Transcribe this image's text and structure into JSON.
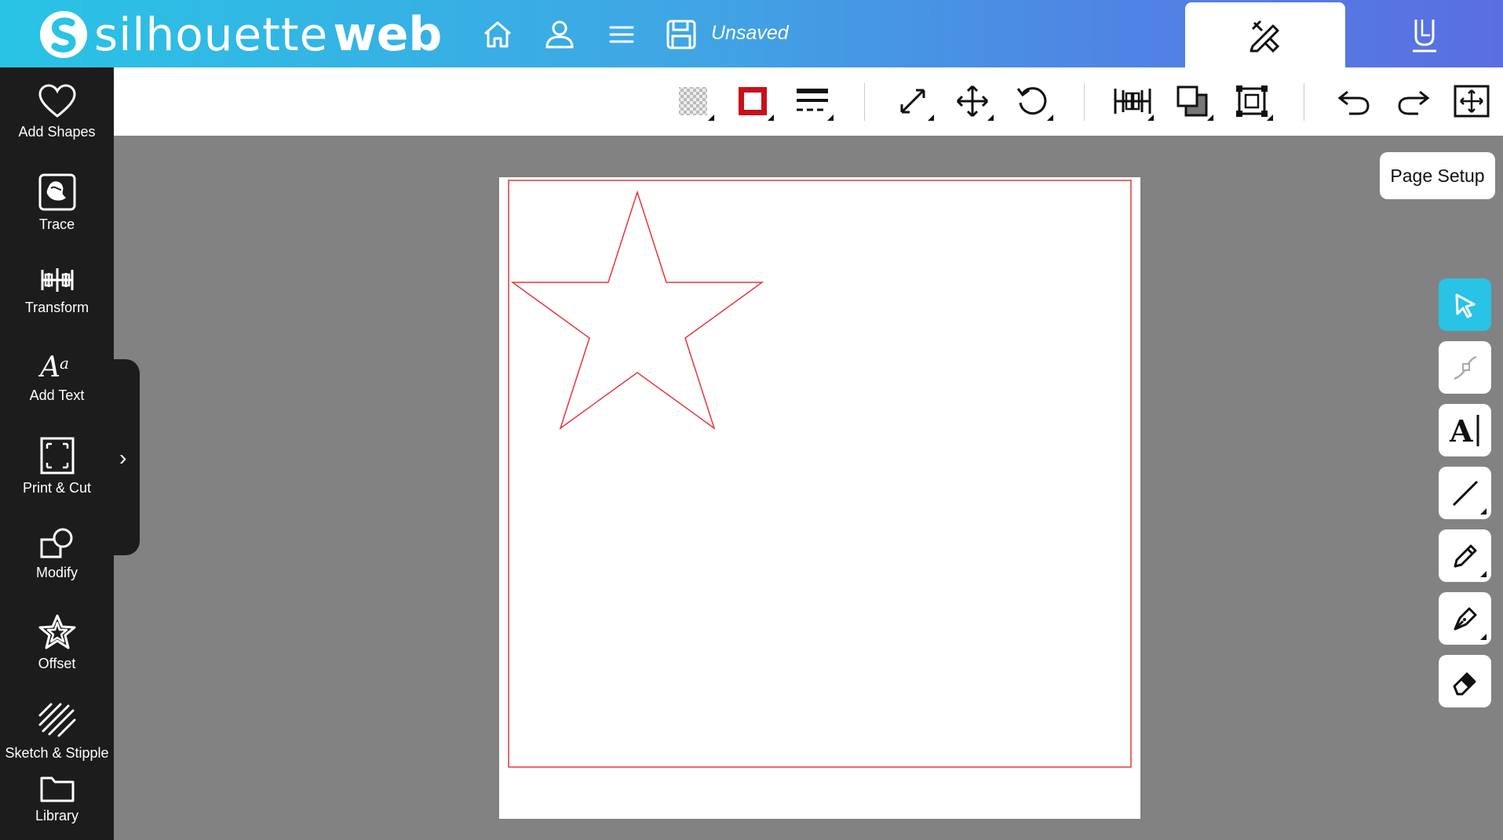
{
  "header": {
    "logo_light": "silhouette",
    "logo_bold": "web",
    "save_status": "Unsaved",
    "icons": [
      "home-icon",
      "account-icon",
      "menu-icon",
      "save-icon"
    ],
    "tabs": [
      "design-tab",
      "send-tab"
    ]
  },
  "sidebar": {
    "items": [
      {
        "label": "Add Shapes",
        "icon": "heart-icon"
      },
      {
        "label": "Trace",
        "icon": "trace-icon"
      },
      {
        "label": "Transform",
        "icon": "transform-icon"
      },
      {
        "label": "Add Text",
        "icon": "text-icon"
      },
      {
        "label": "Print & Cut",
        "icon": "print-cut-icon"
      },
      {
        "label": "Modify",
        "icon": "modify-icon"
      },
      {
        "label": "Offset",
        "icon": "offset-icon"
      },
      {
        "label": "Sketch & Stipple",
        "icon": "sketch-icon"
      },
      {
        "label": "Library",
        "icon": "folder-icon"
      }
    ],
    "flap_toggle": "›"
  },
  "toolbar": {
    "tools": [
      "fill-icon",
      "line-color-icon",
      "line-style-icon",
      "scale-icon",
      "move-icon",
      "rotate-icon",
      "align-icon",
      "arrange-icon",
      "group-icon",
      "undo-icon",
      "redo-icon",
      "pan-icon"
    ]
  },
  "page_setup": {
    "label": "Page Setup"
  },
  "right_tools": [
    "select-icon",
    "edit-points-icon",
    "text-tool-icon",
    "line-tool-icon",
    "pencil-icon",
    "pen-icon",
    "eraser-icon"
  ],
  "colors": {
    "accent": "#29c3e5",
    "cut_line": "#e8363b",
    "canvas_bg": "#828282",
    "sidebar_bg": "#1c1c1c"
  }
}
